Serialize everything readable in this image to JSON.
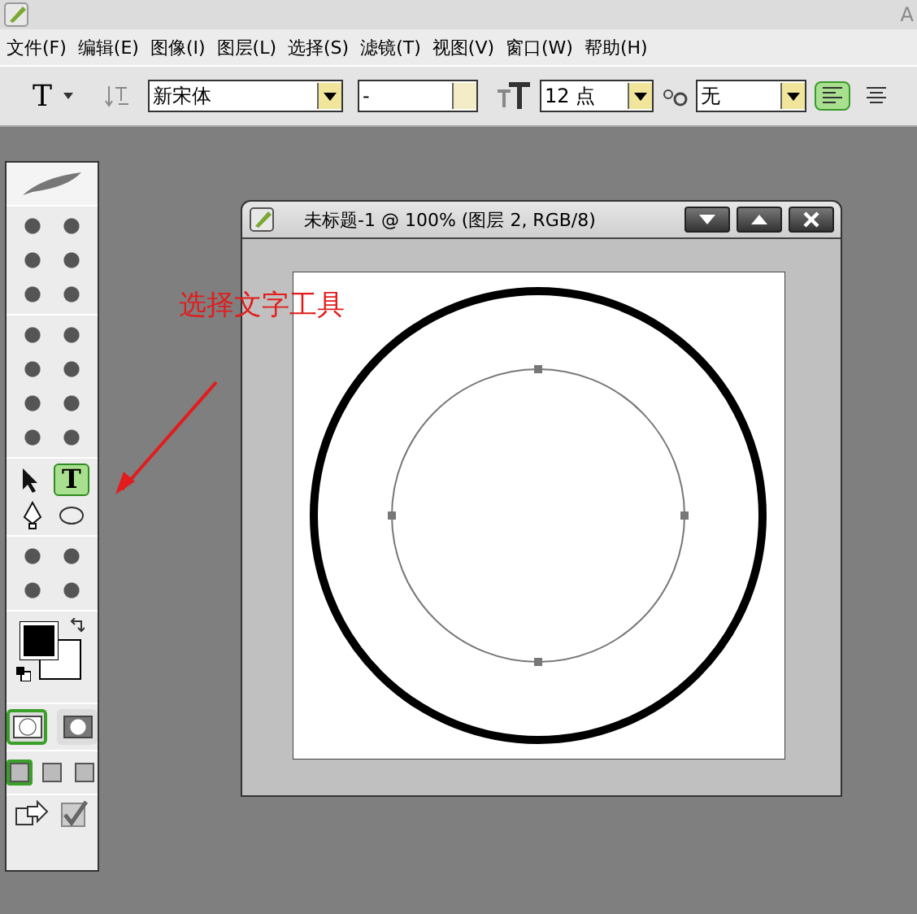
{
  "app_title": "A",
  "menu": [
    "文件(F)",
    "编辑(E)",
    "图像(I)",
    "图层(L)",
    "选择(S)",
    "滤镜(T)",
    "视图(V)",
    "窗口(W)",
    "帮助(H)"
  ],
  "options_bar": {
    "tool_glyph": "T",
    "font_family": "新宋体",
    "font_style": "-",
    "font_size": "12 点",
    "anti_alias": "无",
    "align": [
      {
        "selected": true
      },
      {
        "selected": false
      }
    ]
  },
  "toolbox": {
    "type_tool": {
      "label": "T",
      "selected": true
    },
    "edit_mode": [
      {
        "selected": true
      },
      {
        "selected": false
      }
    ],
    "screen_mode": [
      {
        "selected": true
      },
      {
        "selected": false
      },
      {
        "selected": false
      }
    ]
  },
  "document": {
    "title": "未标题-1 @ 100% (图层 2, RGB/8)"
  },
  "annotation": {
    "text": "选择文字工具"
  }
}
